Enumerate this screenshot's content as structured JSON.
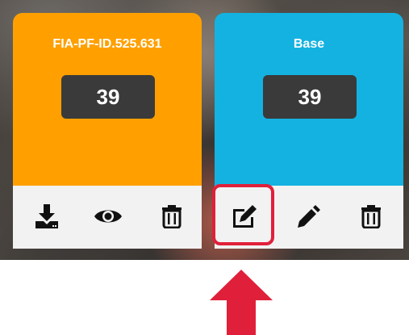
{
  "cards": [
    {
      "title": "FIA-PF-ID.525.631",
      "count": "39",
      "color": "#ffa000",
      "actions": [
        "download-icon",
        "eye-icon",
        "trash-icon"
      ]
    },
    {
      "title": "Base",
      "count": "39",
      "color": "#14b2e0",
      "actions": [
        "edit-box-icon",
        "pencil-icon",
        "trash-icon"
      ]
    }
  ],
  "annotation": {
    "highlight_color": "#e0203a",
    "arrow_color": "#e0203a",
    "highlighted_action": "edit-box-icon"
  }
}
